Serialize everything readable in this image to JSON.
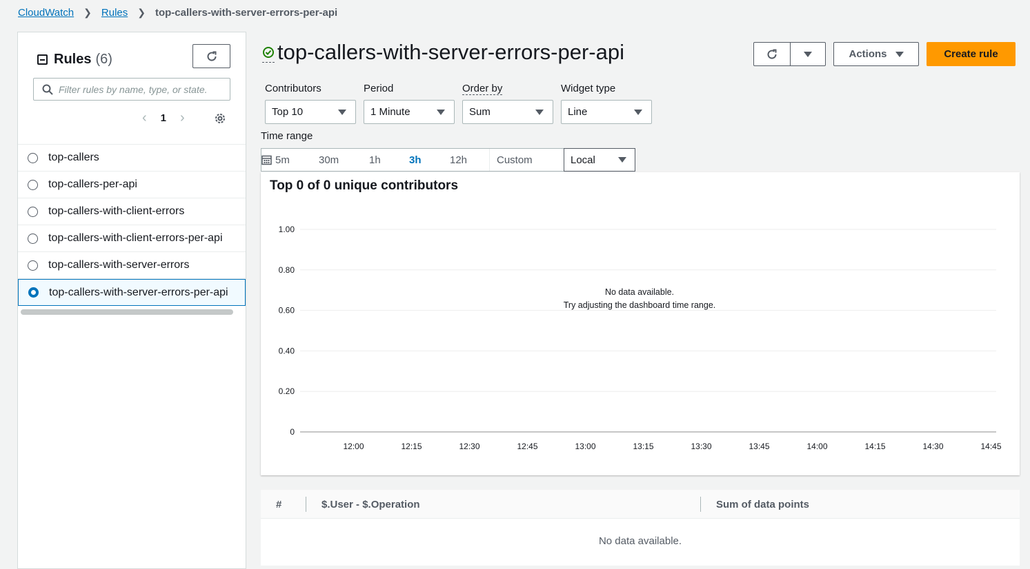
{
  "breadcrumb": {
    "root": "CloudWatch",
    "rules": "Rules",
    "current": "top-callers-with-server-errors-per-api"
  },
  "sidebar": {
    "title": "Rules",
    "count": "(6)",
    "search_placeholder": "Filter rules by name, type, or state.",
    "page": "1",
    "items": [
      {
        "label": "top-callers",
        "selected": false
      },
      {
        "label": "top-callers-per-api",
        "selected": false
      },
      {
        "label": "top-callers-with-client-errors",
        "selected": false
      },
      {
        "label": "top-callers-with-client-errors-per-api",
        "selected": false
      },
      {
        "label": "top-callers-with-server-errors",
        "selected": false
      },
      {
        "label": "top-callers-with-server-errors-per-api",
        "selected": true
      }
    ]
  },
  "header": {
    "title": "top-callers-with-server-errors-per-api",
    "actions_label": "Actions",
    "create_label": "Create rule"
  },
  "filters": {
    "contributors_label": "Contributors",
    "contributors_value": "Top 10",
    "period_label": "Period",
    "period_value": "1 Minute",
    "orderby_label": "Order by",
    "orderby_value": "Sum",
    "widget_label": "Widget type",
    "widget_value": "Line"
  },
  "time_range": {
    "label": "Time range",
    "options": [
      "5m",
      "30m",
      "1h",
      "3h",
      "12h"
    ],
    "active": "3h",
    "custom_label": "Custom",
    "timezone": "Local"
  },
  "panel": {
    "title": "Top 0 of 0 unique contributors",
    "no_data_1": "No data available.",
    "no_data_2": "Try adjusting the dashboard time range."
  },
  "chart_data": {
    "type": "line",
    "title": "Top 0 of 0 unique contributors",
    "series": [],
    "y_ticks": [
      "1.00",
      "0.80",
      "0.60",
      "0.40",
      "0.20",
      "0"
    ],
    "x_ticks": [
      "12:00",
      "12:15",
      "12:30",
      "12:45",
      "13:00",
      "13:15",
      "13:30",
      "13:45",
      "14:00",
      "14:15",
      "14:30",
      "14:45"
    ],
    "ylim": [
      0,
      1
    ],
    "grid": true
  },
  "table": {
    "col_num": "#",
    "col_key": "$.User - $.Operation",
    "col_sum": "Sum of data points",
    "empty": "No data available."
  },
  "colors": {
    "accent": "#0073bb",
    "primary_button": "#ff9900",
    "success": "#1d8102"
  }
}
